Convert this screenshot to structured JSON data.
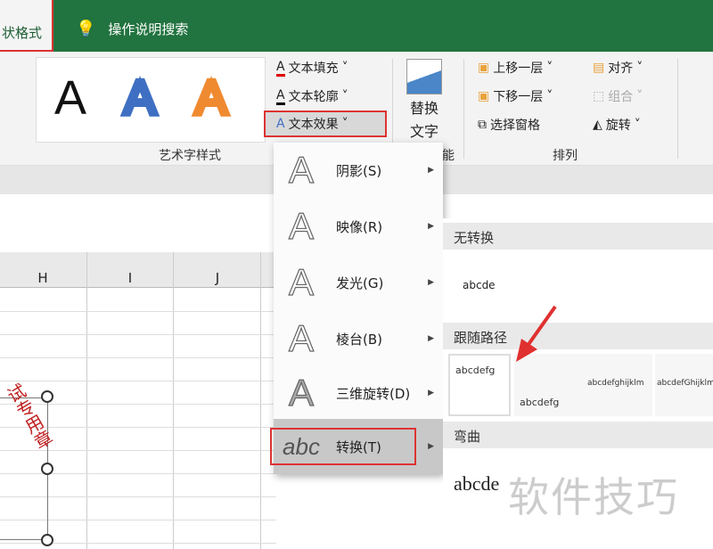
{
  "title_bar": {
    "active_tab": "状格式",
    "search_label": "操作说明搜索"
  },
  "ribbon": {
    "wordart_samples": [
      "A",
      "A",
      "A"
    ],
    "text_fill": "文本填充",
    "text_outline": "文本轮廓",
    "text_effects": "文本效果",
    "wordart_group": "艺术字样式",
    "alt_text": [
      "替换",
      "文字"
    ],
    "accessibility_group_tail": "能",
    "bring_forward": "上移一层",
    "send_backward": "下移一层",
    "selection_pane": "选择窗格",
    "align": "对齐",
    "group": "组合",
    "rotate": "旋转",
    "arrange_group": "排列"
  },
  "sheet": {
    "columns": [
      "H",
      "I",
      "J"
    ],
    "shape_text": "试专用章"
  },
  "effects_menu": {
    "items": [
      {
        "label": "阴影(S)",
        "icon": "A"
      },
      {
        "label": "映像(R)",
        "icon": "A"
      },
      {
        "label": "发光(G)",
        "icon": "A"
      },
      {
        "label": "棱台(B)",
        "icon": "A"
      },
      {
        "label": "三维旋转(D)",
        "icon": "A"
      },
      {
        "label": "转换(T)",
        "icon": "abc"
      }
    ]
  },
  "transform_submenu": {
    "no_transform": "无转换",
    "no_transform_sample": "abcde",
    "follow_path": "跟随路径",
    "path_samples": [
      "abcdefg",
      "abcdefg",
      "abcdefghijklm",
      "abcdefGhijklmnop"
    ],
    "warp": "弯曲",
    "warp_sample": "abcde"
  },
  "watermark": "软件技巧",
  "colors": {
    "excel_green": "#21733f",
    "highlight": "#d33333"
  }
}
